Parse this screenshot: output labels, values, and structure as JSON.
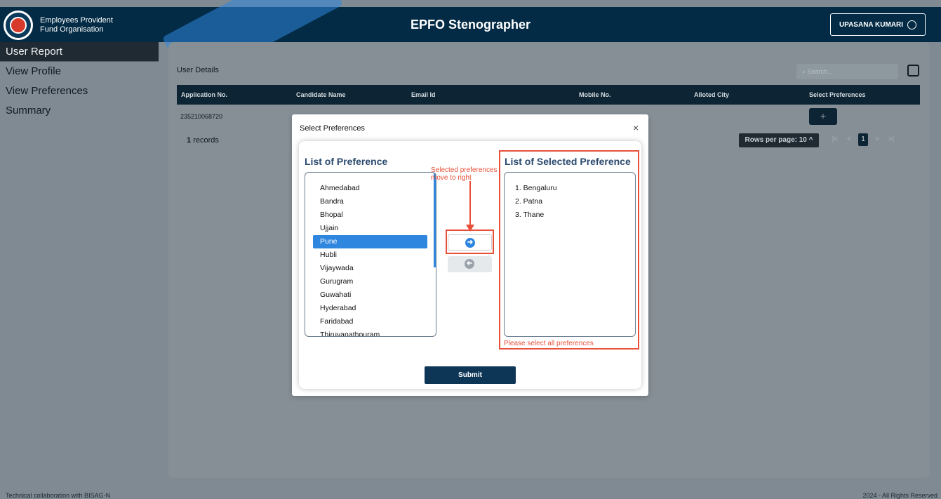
{
  "header": {
    "org_line1": "Employees Provident",
    "org_line2": "Fund Organisation",
    "title": "EPFO Stenographer",
    "user_name": "UPASANA KUMARI"
  },
  "sidebar": {
    "items": [
      {
        "label": "User Report",
        "active": true
      },
      {
        "label": "View Profile",
        "active": false
      },
      {
        "label": "View Preferences",
        "active": false
      },
      {
        "label": "Summary",
        "active": false
      }
    ]
  },
  "main": {
    "card_title": "User Details",
    "search_placeholder": "Search...",
    "table": {
      "columns": [
        "Application No.",
        "Candidate Name",
        "Email Id",
        "Mobile No.",
        "Alloted City",
        "Select Preferences"
      ],
      "rows": [
        {
          "application_no": "235210068720",
          "action": "+"
        }
      ]
    },
    "records_count": "1",
    "records_label": "records",
    "rows_per_page": "Rows per page: 10",
    "pagination": {
      "first": "|<",
      "prev": "<",
      "current": "1",
      "next": ">",
      "last": ">|"
    }
  },
  "modal": {
    "title": "Select Preferences",
    "close": "×",
    "left_heading": "List of Preference",
    "right_heading": "List of Selected Preference",
    "available": [
      "Ahmedabad",
      "Bandra",
      "Bhopal",
      "Ujjain",
      "Pune",
      "Hubli",
      "Vijaywada",
      "Gurugram",
      "Guwahati",
      "Hyderabad",
      "Faridabad",
      "Thiruvanathpuram"
    ],
    "selected_available_index": 4,
    "selected": [
      "1. Bengaluru",
      "2. Patna",
      "3. Thane"
    ],
    "annotation_line1": "Selected preferences",
    "annotation_line2": "move to right",
    "error": "Please select all preferences",
    "submit_label": "Submit"
  },
  "footer": {
    "left": "Technical collaboration with BISAG-N",
    "right": "2024 - All Rights Reserved"
  },
  "colors": {
    "header_bg": "#032b45",
    "accent_blue": "#2e86de",
    "annotation_red": "#e8503a",
    "submit_bg": "#0c3556"
  }
}
